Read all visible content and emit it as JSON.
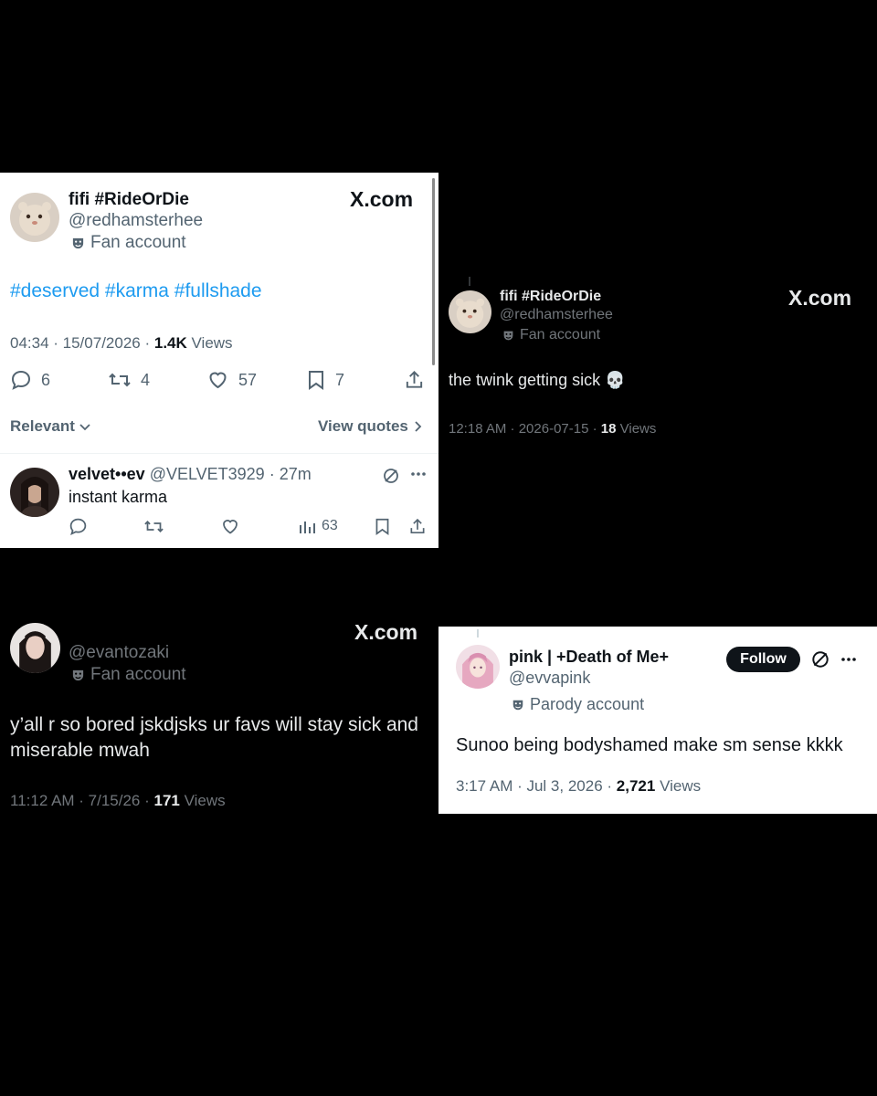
{
  "tweet1": {
    "display_name": "fifi #RideOrDie",
    "handle": "@redhamsterhee",
    "badge": "Fan account",
    "brand": "X.com",
    "hashtags": [
      "#deserved",
      "#karma",
      "#fullshade"
    ],
    "time": "04:34 · 15/07/2026 ·",
    "views_count": "1.4K",
    "views_label": "Views",
    "stats": {
      "replies": "6",
      "reposts": "4",
      "likes": "57",
      "bookmarks": "7"
    },
    "sort_label": "Relevant",
    "view_quotes": "View quotes",
    "reply": {
      "display_name": "velvet••ev",
      "meta": "@VELVET3929 · 27m",
      "text": "instant karma",
      "views": "63"
    }
  },
  "tweet2": {
    "display_name": "fifi #RideOrDie",
    "handle": "@redhamsterhee",
    "badge": "Fan account",
    "brand": "X.com",
    "text": "the twink getting sick 💀",
    "time": "12:18 AM · 2026-07-15 ·",
    "views_count": "18",
    "views_label": "Views"
  },
  "tweet3": {
    "handle": "@evantozaki",
    "badge": "Fan account",
    "brand": "X.com",
    "text_line1": "y’all r so bored jskdjsks ur favs will stay sick and",
    "text_line2": "miserable mwah",
    "time": "11:12 AM · 7/15/26 ·",
    "views_count": "171",
    "views_label": "Views"
  },
  "tweet4": {
    "display_name": "pink | +Death of Me+",
    "handle": "@evvapink",
    "badge": "Parody account",
    "follow_label": "Follow",
    "text": "Sunoo being bodyshamed make sm sense kkkk",
    "time": "3:17 AM · Jul 3, 2026 ·",
    "views_count": "2,721",
    "views_label": "Views"
  },
  "colors": {
    "accent_link": "#1d9bf0",
    "secondary_text_light": "#536471",
    "secondary_text_dark": "#71767b"
  }
}
